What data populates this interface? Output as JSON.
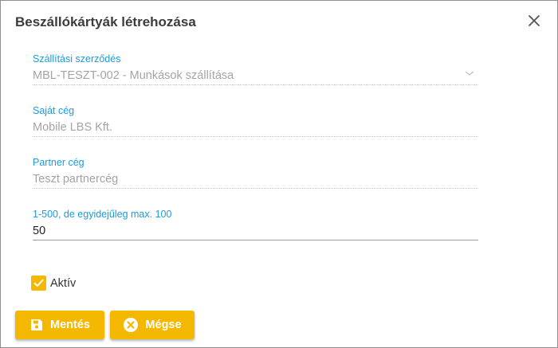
{
  "dialog": {
    "title": "Beszállókártyák létrehozása",
    "close_icon": "close-icon"
  },
  "form": {
    "contract": {
      "label": "Szállítási szerződés",
      "value": "MBL-TESZT-002 - Munkások szállítása",
      "icon": "chevron-down-icon"
    },
    "own_company": {
      "label": "Saját cég",
      "value": "Mobile LBS Kft."
    },
    "partner_company": {
      "label": "Partner cég",
      "value": "Teszt partnercég"
    },
    "quantity": {
      "label": "1-500, de egyidejűleg max. 100",
      "value": "50"
    },
    "active": {
      "label": "Aktív",
      "checked": true
    }
  },
  "buttons": {
    "save": {
      "label": "Mentés",
      "icon": "save-icon"
    },
    "cancel": {
      "label": "Mégse",
      "icon": "cancel-icon"
    }
  },
  "colors": {
    "accent": "#f5b800",
    "label": "#1a9be0",
    "title": "#3c3c3c",
    "disabled_text": "#a4a4a4"
  }
}
